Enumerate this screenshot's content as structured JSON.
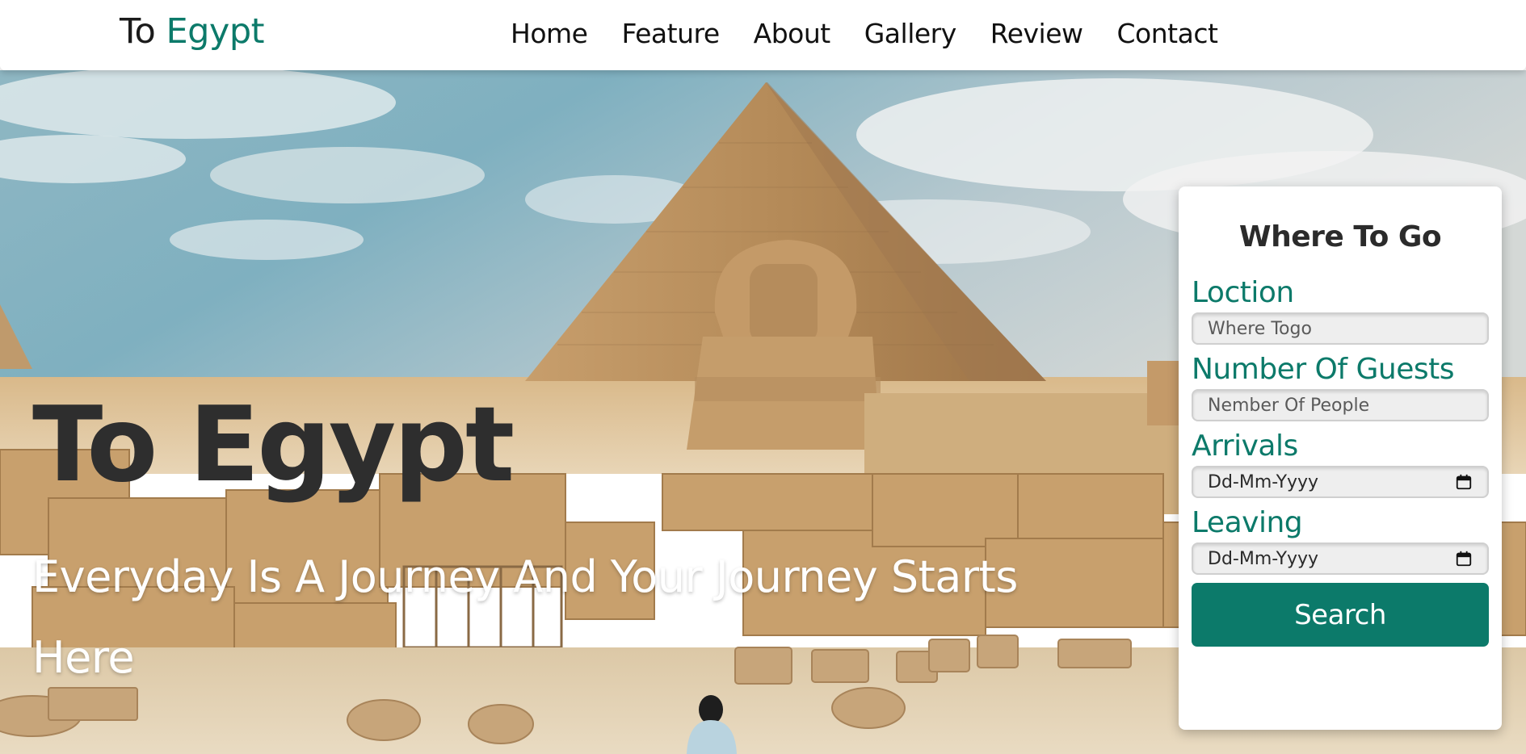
{
  "header": {
    "logo_prefix": "To",
    "logo_accent": "Egypt",
    "nav": [
      "Home",
      "Feature",
      "About",
      "Gallery",
      "Review",
      "Contact"
    ]
  },
  "hero": {
    "title": "To Egypt",
    "subtitle": "Everyday Is A Journey And Your Journey Starts Here",
    "background_image": "pyramid-and-sphinx-photo"
  },
  "form": {
    "title": "Where To Go",
    "location_label": "Loction",
    "location_placeholder": "Where Togo",
    "guests_label": "Number Of Guests",
    "guests_placeholder": "Nember Of People",
    "arrivals_label": "Arrivals",
    "arrivals_value": "Dd-Mm-Yyyy",
    "leaving_label": "Leaving",
    "leaving_value": "Dd-Mm-Yyyy",
    "search_label": "Search"
  },
  "colors": {
    "accent": "#0c7a6a",
    "title_dark": "#2e2e2e",
    "header_bg": "#ffffff"
  }
}
